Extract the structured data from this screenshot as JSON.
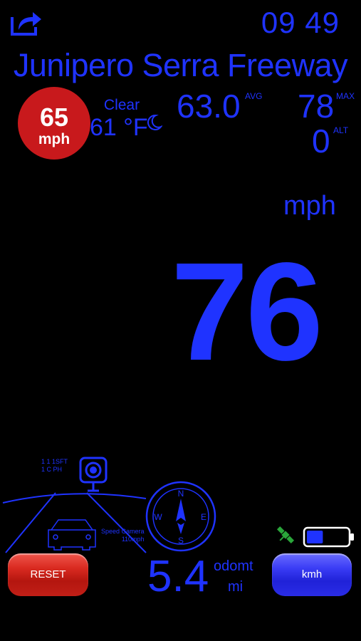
{
  "header": {
    "share_icon": "share-icon",
    "clock": "09 49"
  },
  "road_name": "Junipero Serra Freeway",
  "speed_limit": {
    "value": "65",
    "unit": "mph"
  },
  "weather": {
    "condition": "Clear",
    "temperature": "61 °F",
    "icon": "moon-icon"
  },
  "stats": {
    "avg_value": "63.0",
    "avg_label": "AVG",
    "max_value": "78",
    "max_label": "MAX",
    "alt_value": "0",
    "alt_label": "ALT"
  },
  "speed": {
    "unit": "mph",
    "value": "76"
  },
  "camera_warning": {
    "distance": "1 1 1SFT",
    "limit": "1 C PH",
    "speed_camera_label": "Speed Camera",
    "speed_camera_value": "110mph",
    "icon": "speed-camera-icon"
  },
  "compass": {
    "n": "N",
    "e": "E",
    "s": "S",
    "w": "W",
    "heading_degrees": 0
  },
  "odometer": {
    "value": "5.4",
    "label": "odomt",
    "unit": "mi"
  },
  "buttons": {
    "reset": "RESET",
    "unit_toggle": "kmh"
  },
  "status": {
    "gps_icon": "satellite-icon",
    "battery_level": 0.4
  },
  "colors": {
    "primary": "#1f33ff",
    "limit_red": "#c8191c",
    "gps_green": "#2aa63a"
  }
}
